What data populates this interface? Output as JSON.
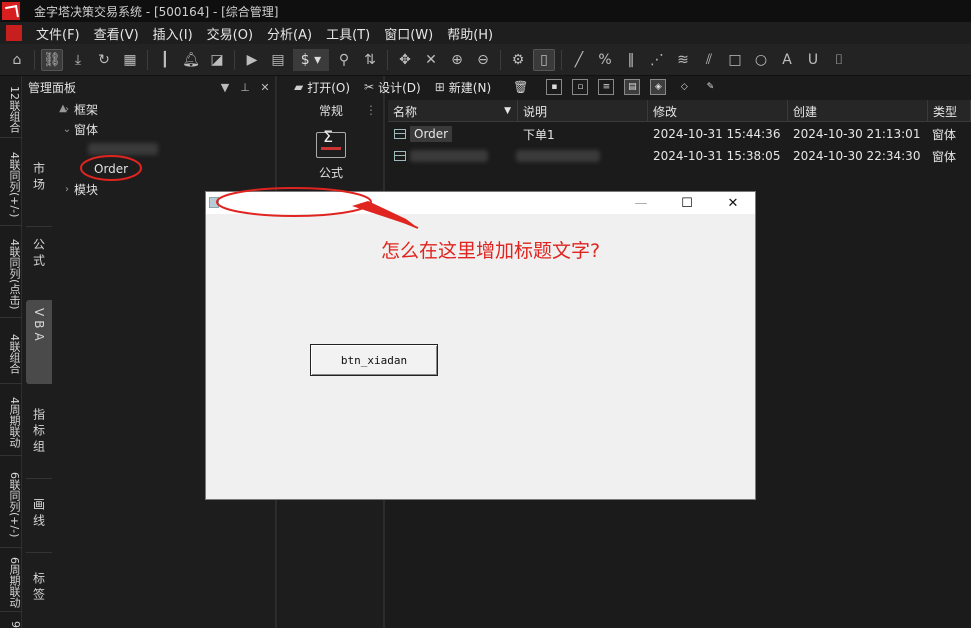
{
  "window": {
    "title": "金字塔决策交易系统 - [500164] - [综合管理]"
  },
  "menu": [
    "文件(F)",
    "查看(V)",
    "插入(I)",
    "交易(O)",
    "分析(A)",
    "工具(T)",
    "窗口(W)",
    "帮助(H)"
  ],
  "toolbar": {
    "dollar_label": "$"
  },
  "left_tabs": [
    "12联组合",
    "4联同列(+/-)",
    "4联同列(点击)",
    "4联组合",
    "4周期联动",
    "6联同列(+/-)",
    "6周期联动",
    "9"
  ],
  "mgmt_panel": {
    "title": "管理面板",
    "pin_icon": "pin-icon",
    "close_icon": "close-icon",
    "categories": [
      "市场",
      "公式",
      "VBA",
      "指标组",
      "画线",
      "标签"
    ],
    "active_category": "VBA",
    "tree": {
      "framework": "框架",
      "forms": "窗体",
      "form_order": "Order",
      "modules": "模块"
    }
  },
  "toolbox": {
    "header": "常规",
    "formula_label": "公式"
  },
  "action_bar": {
    "open": "打开(O)",
    "design": "设计(D)",
    "new": "新建(N)"
  },
  "table": {
    "headers": [
      "名称",
      "说明",
      "修改",
      "创建",
      "类型"
    ],
    "rows": [
      {
        "name": "Order",
        "desc": "下单1",
        "modified": "2024-10-31 15:44:36",
        "created": "2024-10-30 21:13:01",
        "type": "窗体"
      },
      {
        "name": "",
        "desc": "",
        "modified": "2024-10-31 15:38:05",
        "created": "2024-10-30 22:34:30",
        "type": "窗体"
      }
    ]
  },
  "dialog": {
    "title": "",
    "button_label": "btn_xiadan"
  },
  "annotation": {
    "text": "怎么在这里增加标题文字?",
    "color": "#e0241f"
  }
}
